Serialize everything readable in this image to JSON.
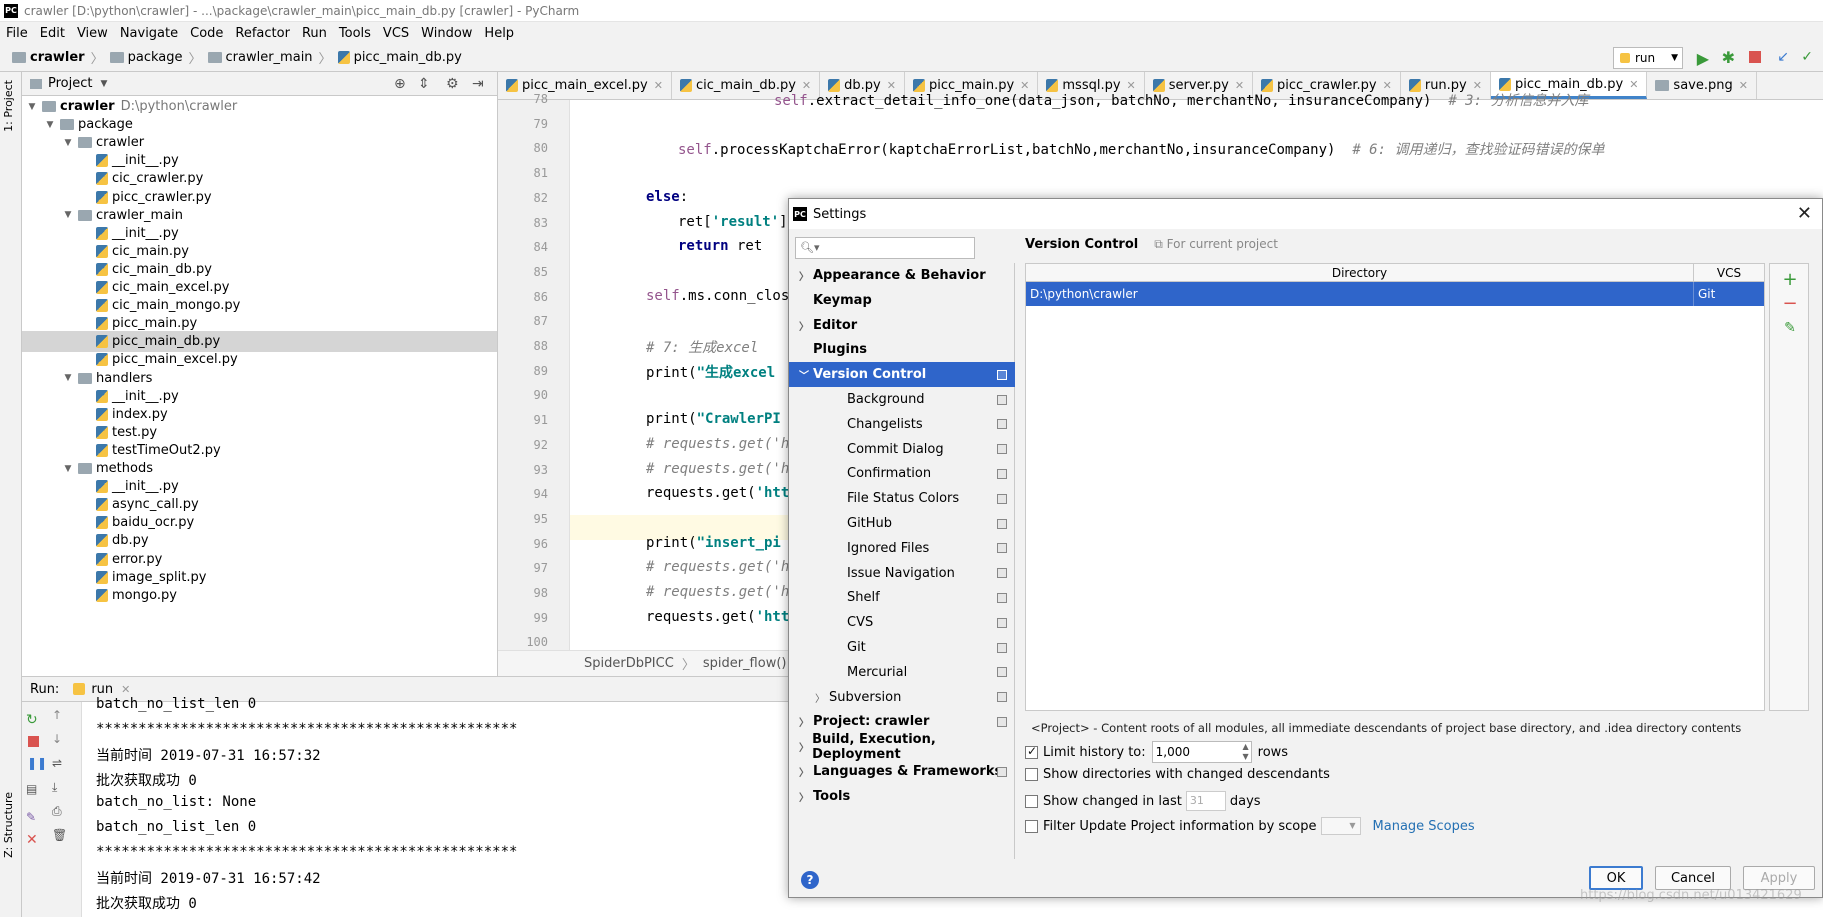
{
  "window_title": "crawler [D:\\python\\crawler] - ...\\package\\crawler_main\\picc_main_db.py [crawler] - PyCharm",
  "menu": [
    "File",
    "Edit",
    "View",
    "Navigate",
    "Code",
    "Refactor",
    "Run",
    "Tools",
    "VCS",
    "Window",
    "Help"
  ],
  "breadcrumb": [
    "crawler",
    "package",
    "crawler_main",
    "picc_main_db.py"
  ],
  "run_config": "run",
  "side_tabs": {
    "project": "1: Project",
    "structure": "Z: Structure"
  },
  "project_panel": {
    "title": "Project",
    "tree": [
      {
        "label": "crawler",
        "hint": "D:\\python\\crawler",
        "kind": "folder",
        "depth": 0,
        "bold": true
      },
      {
        "label": "package",
        "kind": "folder",
        "depth": 1
      },
      {
        "label": "crawler",
        "kind": "folder",
        "depth": 2
      },
      {
        "label": "__init__.py",
        "kind": "py",
        "depth": 3
      },
      {
        "label": "cic_crawler.py",
        "kind": "py",
        "depth": 3
      },
      {
        "label": "picc_crawler.py",
        "kind": "py",
        "depth": 3
      },
      {
        "label": "crawler_main",
        "kind": "folder",
        "depth": 2
      },
      {
        "label": "__init__.py",
        "kind": "py",
        "depth": 3
      },
      {
        "label": "cic_main.py",
        "kind": "py",
        "depth": 3
      },
      {
        "label": "cic_main_db.py",
        "kind": "py",
        "depth": 3
      },
      {
        "label": "cic_main_excel.py",
        "kind": "py",
        "depth": 3
      },
      {
        "label": "cic_main_mongo.py",
        "kind": "py",
        "depth": 3
      },
      {
        "label": "picc_main.py",
        "kind": "py",
        "depth": 3
      },
      {
        "label": "picc_main_db.py",
        "kind": "py",
        "depth": 3,
        "selected": true
      },
      {
        "label": "picc_main_excel.py",
        "kind": "py",
        "depth": 3
      },
      {
        "label": "handlers",
        "kind": "folder",
        "depth": 2
      },
      {
        "label": "__init__.py",
        "kind": "py",
        "depth": 3
      },
      {
        "label": "index.py",
        "kind": "py",
        "depth": 3
      },
      {
        "label": "test.py",
        "kind": "py",
        "depth": 3
      },
      {
        "label": "testTimeOut2.py",
        "kind": "py",
        "depth": 3
      },
      {
        "label": "methods",
        "kind": "folder",
        "depth": 2
      },
      {
        "label": "__init__.py",
        "kind": "py",
        "depth": 3
      },
      {
        "label": "async_call.py",
        "kind": "py",
        "depth": 3
      },
      {
        "label": "baidu_ocr.py",
        "kind": "py",
        "depth": 3
      },
      {
        "label": "db.py",
        "kind": "py",
        "depth": 3
      },
      {
        "label": "error.py",
        "kind": "py",
        "depth": 3
      },
      {
        "label": "image_split.py",
        "kind": "py",
        "depth": 3
      },
      {
        "label": "mongo.py",
        "kind": "py",
        "depth": 3
      }
    ]
  },
  "editor_tabs": [
    {
      "label": "picc_main_excel.py",
      "x": 14
    },
    {
      "label": "cic_main_db.py",
      "x": 0
    },
    {
      "label": "db.py",
      "x": 0
    },
    {
      "label": "picc_main.py",
      "x": 0
    },
    {
      "label": "mssql.py",
      "x": 0
    },
    {
      "label": "server.py",
      "x": 0
    },
    {
      "label": "picc_crawler.py",
      "x": 0
    },
    {
      "label": "run.py",
      "x": 0
    },
    {
      "label": "picc_main_db.py",
      "x": 0,
      "active": true
    },
    {
      "label": "save.png",
      "x": 0
    }
  ],
  "code_lines": [
    {
      "n": "78",
      "html": "<span class='self'>self</span>.extract_detail_info_one(data_json, batchNo, merchantNo, insuranceCompany)  <span class='cmt'># 3: 分析信息并入库</span>",
      "indent": 4
    },
    {
      "n": "79",
      "html": "",
      "indent": 0
    },
    {
      "n": "80",
      "html": "<span class='self'>self</span>.processKaptchaError(kaptchaErrorList,batchNo,merchantNo,insuranceCompany)  <span class='cmt'># 6: 调用递归，查找验证码错误的保单</span>",
      "indent": 1
    },
    {
      "n": "81",
      "html": "",
      "indent": 0
    },
    {
      "n": "82",
      "html": "<span class='kw'>else</span>:",
      "indent": 0
    },
    {
      "n": "83",
      "html": "ret[<span class='str'>'result'</span>]",
      "indent": 1
    },
    {
      "n": "84",
      "html": "<span class='kw'>return</span> ret",
      "indent": 1
    },
    {
      "n": "85",
      "html": "",
      "indent": 0
    },
    {
      "n": "86",
      "html": "<span class='self'>self</span>.ms.conn_close",
      "indent": 0
    },
    {
      "n": "87",
      "html": "",
      "indent": 0
    },
    {
      "n": "88",
      "html": "<span class='cmt'># 7: 生成excel</span>",
      "indent": 0
    },
    {
      "n": "89",
      "html": "print(<span class='str'>\"生成excel</span>",
      "indent": 0
    },
    {
      "n": "90",
      "html": "",
      "indent": 0
    },
    {
      "n": "91",
      "html": "print(<span class='str'>\"CrawlerPI</span>",
      "indent": 0
    },
    {
      "n": "92",
      "html": "<span class='cmt'># requests.get('ht</span>",
      "indent": 0
    },
    {
      "n": "93",
      "html": "<span class='cmt'># requests.get('ht</span>",
      "indent": 0
    },
    {
      "n": "94",
      "html": "requests.get(<span class='str'>'htt</span>",
      "indent": 0
    },
    {
      "n": "95",
      "html": "",
      "indent": 0
    },
    {
      "n": "96",
      "html": "print(<span class='str'>\"insert_pi</span>",
      "indent": 0
    },
    {
      "n": "97",
      "html": "<span class='cmt'># requests.get('ht</span>",
      "indent": 0
    },
    {
      "n": "98",
      "html": "<span class='cmt'># requests.get('ht</span>",
      "indent": 0
    },
    {
      "n": "99",
      "html": "requests.get(<span class='str'>'htt</span>",
      "indent": 0
    },
    {
      "n": "100",
      "html": "",
      "indent": 0
    }
  ],
  "editor_breadcrumb": [
    "SpiderDbPICC",
    "spider_flow()"
  ],
  "run_panel": {
    "label": "Run:",
    "tab": "run",
    "output": [
      "batch_no_list_len 0",
      "**************************************************",
      "当前时间 2019-07-31 16:57:32",
      "批次获取成功 0",
      "batch_no_list: None",
      "batch_no_list_len 0",
      "**************************************************",
      "当前时间 2019-07-31 16:57:42",
      "批次获取成功 0"
    ]
  },
  "settings": {
    "title": "Settings",
    "search_placeholder": "",
    "nav": [
      {
        "label": "Appearance & Behavior",
        "bold": true,
        "expand": "right",
        "depth": 0
      },
      {
        "label": "Keymap",
        "bold": true,
        "depth": 0
      },
      {
        "label": "Editor",
        "bold": true,
        "expand": "right",
        "depth": 0
      },
      {
        "label": "Plugins",
        "bold": true,
        "depth": 0
      },
      {
        "label": "Version Control",
        "bold": true,
        "expand": "down",
        "depth": 0,
        "selected": true,
        "copy": true
      },
      {
        "label": "Background",
        "depth": 1,
        "copy": true
      },
      {
        "label": "Changelists",
        "depth": 1,
        "copy": true
      },
      {
        "label": "Commit Dialog",
        "depth": 1,
        "copy": true
      },
      {
        "label": "Confirmation",
        "depth": 1,
        "copy": true
      },
      {
        "label": "File Status Colors",
        "depth": 1,
        "copy": true
      },
      {
        "label": "GitHub",
        "depth": 1,
        "copy": true
      },
      {
        "label": "Ignored Files",
        "depth": 1,
        "copy": true
      },
      {
        "label": "Issue Navigation",
        "depth": 1,
        "copy": true
      },
      {
        "label": "Shelf",
        "depth": 1,
        "copy": true
      },
      {
        "label": "CVS",
        "depth": 1,
        "copy": true
      },
      {
        "label": "Git",
        "depth": 1,
        "copy": true
      },
      {
        "label": "Mercurial",
        "depth": 1,
        "copy": true
      },
      {
        "label": "Subversion",
        "depth": 1,
        "expand": "right",
        "copy": true
      },
      {
        "label": "Project: crawler",
        "bold": true,
        "expand": "right",
        "depth": 0,
        "copy": true
      },
      {
        "label": "Build, Execution, Deployment",
        "bold": true,
        "expand": "right",
        "depth": 0
      },
      {
        "label": "Languages & Frameworks",
        "bold": true,
        "expand": "right",
        "depth": 0,
        "copy": true
      },
      {
        "label": "Tools",
        "bold": true,
        "expand": "right",
        "depth": 0
      }
    ],
    "page_title": "Version Control",
    "page_hint": "For current project",
    "table": {
      "col_directory": "Directory",
      "col_vcs": "VCS",
      "rows": [
        {
          "directory": "D:\\python\\crawler",
          "vcs": "Git"
        }
      ]
    },
    "project_note": "<Project> - Content roots of all modules, all immediate descendants of project base directory, and .idea directory contents",
    "limit_history_label": "Limit history to:",
    "limit_history_value": "1,000",
    "limit_history_unit": "rows",
    "show_dirs_label": "Show directories with changed descendants",
    "show_changed_label": "Show changed in last",
    "show_changed_value": "31",
    "show_changed_unit": "days",
    "filter_update_label": "Filter Update Project information by scope",
    "manage_scopes": "Manage Scopes",
    "ok": "OK",
    "cancel": "Cancel",
    "apply": "Apply",
    "help": "?"
  },
  "watermark": "https://blog.csdn.net/u013421629"
}
